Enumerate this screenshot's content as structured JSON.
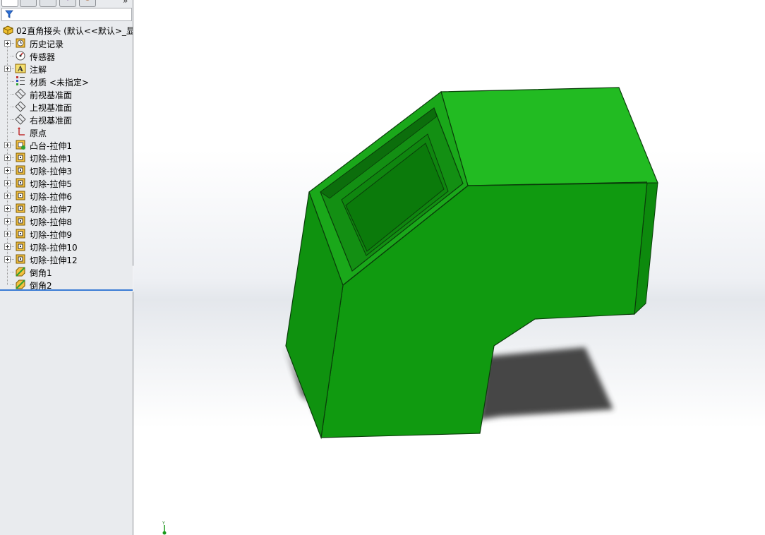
{
  "tree": {
    "root_label": "02直角接头 (默认<<默认>_显",
    "items": [
      {
        "label": "历史记录",
        "icon": "history-icon",
        "expandable": true
      },
      {
        "label": "传感器",
        "icon": "sensor-icon",
        "expandable": false
      },
      {
        "label": "注解",
        "icon": "annotation-icon",
        "expandable": true
      },
      {
        "label": "材质 <未指定>",
        "icon": "material-icon",
        "expandable": false
      },
      {
        "label": "前视基准面",
        "icon": "plane-icon",
        "expandable": false
      },
      {
        "label": "上视基准面",
        "icon": "plane-icon",
        "expandable": false
      },
      {
        "label": "右视基准面",
        "icon": "plane-icon",
        "expandable": false
      },
      {
        "label": "原点",
        "icon": "origin-icon",
        "expandable": false
      },
      {
        "label": "凸台-拉伸1",
        "icon": "boss-extrude-icon",
        "expandable": true
      },
      {
        "label": "切除-拉伸1",
        "icon": "cut-extrude-icon",
        "expandable": true
      },
      {
        "label": "切除-拉伸3",
        "icon": "cut-extrude-icon",
        "expandable": true
      },
      {
        "label": "切除-拉伸5",
        "icon": "cut-extrude-icon",
        "expandable": true
      },
      {
        "label": "切除-拉伸6",
        "icon": "cut-extrude-icon",
        "expandable": true
      },
      {
        "label": "切除-拉伸7",
        "icon": "cut-extrude-icon",
        "expandable": true
      },
      {
        "label": "切除-拉伸8",
        "icon": "cut-extrude-icon",
        "expandable": true
      },
      {
        "label": "切除-拉伸9",
        "icon": "cut-extrude-icon",
        "expandable": true
      },
      {
        "label": "切除-拉伸10",
        "icon": "cut-extrude-icon",
        "expandable": true
      },
      {
        "label": "切除-拉伸12",
        "icon": "cut-extrude-icon",
        "expandable": true
      },
      {
        "label": "倒角1",
        "icon": "chamfer-icon",
        "expandable": false
      },
      {
        "label": "倒角2",
        "icon": "chamfer-icon",
        "expandable": false
      }
    ]
  },
  "panel": {
    "tabs": [
      "feature-manager-tab",
      "property-manager-tab",
      "configuration-manager-tab",
      "dimxpert-tab",
      "display-manager-tab"
    ],
    "more_label": "»"
  },
  "viewport": {
    "triad_label": "Y",
    "colors": {
      "top_face": "#22bb22",
      "front_face": "#109a10",
      "side_face": "#0d8a0d",
      "edge": "#0a3d0a",
      "shadow": "#404040"
    }
  }
}
